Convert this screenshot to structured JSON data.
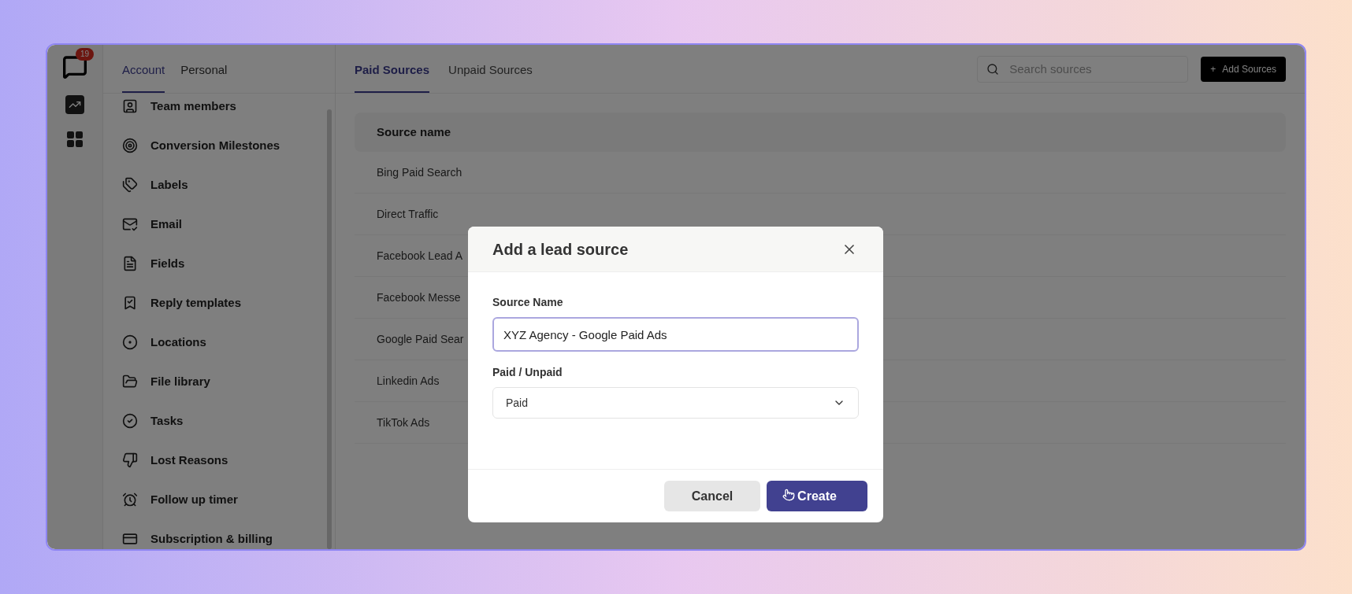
{
  "rail": {
    "badge": "19"
  },
  "settings_tabs": [
    {
      "label": "Account",
      "selected": true
    },
    {
      "label": "Personal",
      "selected": false
    }
  ],
  "settings_menu": [
    "Team members",
    "Conversion Milestones",
    "Labels",
    "Email",
    "Fields",
    "Reply templates",
    "Locations",
    "File library",
    "Tasks",
    "Lost Reasons",
    "Follow up timer",
    "Subscription & billing"
  ],
  "source_tabs": [
    {
      "label": "Paid Sources",
      "selected": true
    },
    {
      "label": "Unpaid Sources",
      "selected": false
    }
  ],
  "search": {
    "placeholder": "Search sources"
  },
  "add_button": {
    "icon": "+",
    "label": "Add Sources"
  },
  "table": {
    "columns": [
      "Source name"
    ],
    "rows": [
      "Bing Paid Search",
      "Direct Traffic",
      "Facebook Lead A",
      "Facebook Messe",
      "Google Paid Sear",
      "Linkedin Ads",
      "TikTok Ads"
    ]
  },
  "modal": {
    "title": "Add a lead source",
    "fields": [
      {
        "kind": "text",
        "label": "Source Name",
        "value": "XYZ Agency - Google Paid Ads",
        "focused": true
      },
      {
        "kind": "select",
        "label": "Paid / Unpaid",
        "value": "Paid",
        "focused": false
      }
    ],
    "buttons": [
      {
        "label": "Cancel",
        "kind": "secondary"
      },
      {
        "label": "Create",
        "kind": "primary"
      }
    ]
  }
}
